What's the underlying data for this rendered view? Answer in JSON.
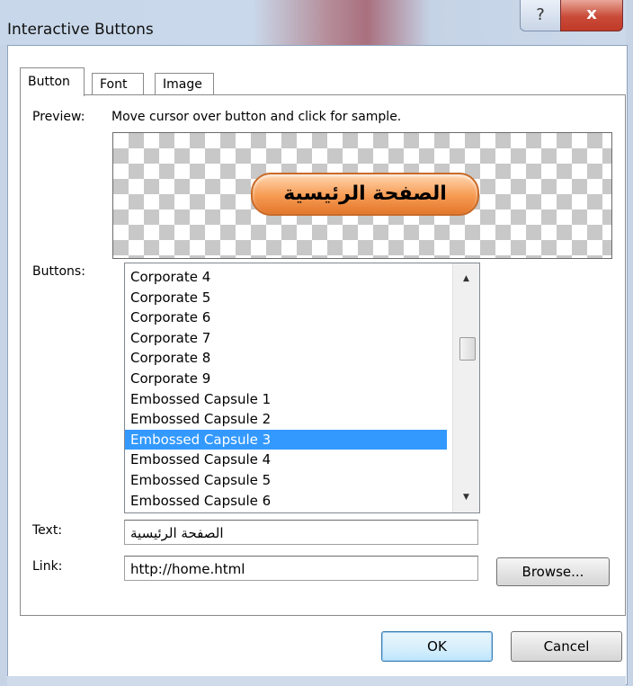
{
  "window": {
    "title": "Interactive Buttons",
    "help_glyph": "?",
    "close_glyph": "x"
  },
  "tabs": [
    {
      "label": "Button"
    },
    {
      "label": "Font"
    },
    {
      "label": "Image"
    }
  ],
  "preview": {
    "label": "Preview:",
    "hint": "Move cursor over button and click for sample.",
    "sample_text": "الصفحة الرئيسية"
  },
  "buttons_list": {
    "label": "Buttons:",
    "items": [
      "Corporate 4",
      "Corporate 5",
      "Corporate 6",
      "Corporate 7",
      "Corporate 8",
      "Corporate 9",
      "Embossed Capsule 1",
      "Embossed Capsule 2",
      "Embossed Capsule 3",
      "Embossed Capsule 4",
      "Embossed Capsule 5",
      "Embossed Capsule 6"
    ],
    "selected": "Embossed Capsule 3"
  },
  "text_field": {
    "label": "Text:",
    "value": "الصفحة الرئيسية"
  },
  "link_field": {
    "label": "Link:",
    "value": "http://home.html"
  },
  "browse_label": "Browse...",
  "ok_label": "OK",
  "cancel_label": "Cancel",
  "colors": {
    "selection": "#3399ff",
    "sample_button": "#f79a52",
    "close_button": "#c94a38"
  }
}
